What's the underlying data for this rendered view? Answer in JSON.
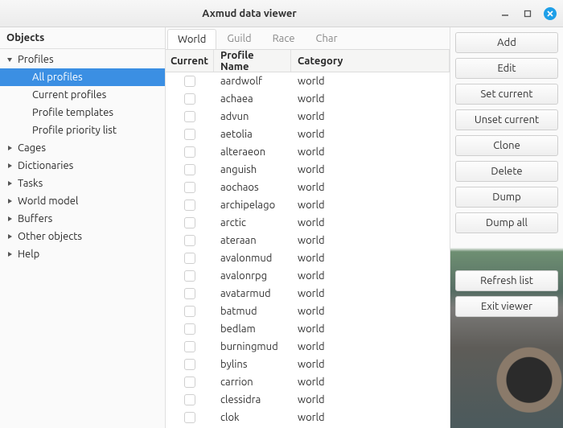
{
  "window": {
    "title": "Axmud data viewer"
  },
  "sidebar": {
    "header": "Objects",
    "items": [
      {
        "label": "Profiles",
        "expanded": true,
        "children": [
          {
            "label": "All profiles",
            "selected": true
          },
          {
            "label": "Current profiles"
          },
          {
            "label": "Profile templates"
          },
          {
            "label": "Profile priority list"
          }
        ]
      },
      {
        "label": "Cages"
      },
      {
        "label": "Dictionaries"
      },
      {
        "label": "Tasks"
      },
      {
        "label": "World model"
      },
      {
        "label": "Buffers"
      },
      {
        "label": "Other objects"
      },
      {
        "label": "Help"
      }
    ]
  },
  "tabs": [
    {
      "label": "World",
      "active": true
    },
    {
      "label": "Guild"
    },
    {
      "label": "Race"
    },
    {
      "label": "Char"
    }
  ],
  "columns": {
    "current": "Current",
    "name": "Profile Name",
    "category": "Category"
  },
  "rows": [
    {
      "name": "aardwolf",
      "category": "world"
    },
    {
      "name": "achaea",
      "category": "world"
    },
    {
      "name": "advun",
      "category": "world"
    },
    {
      "name": "aetolia",
      "category": "world"
    },
    {
      "name": "alteraeon",
      "category": "world"
    },
    {
      "name": "anguish",
      "category": "world"
    },
    {
      "name": "aochaos",
      "category": "world"
    },
    {
      "name": "archipelago",
      "category": "world"
    },
    {
      "name": "arctic",
      "category": "world"
    },
    {
      "name": "ateraan",
      "category": "world"
    },
    {
      "name": "avalonmud",
      "category": "world"
    },
    {
      "name": "avalonrpg",
      "category": "world"
    },
    {
      "name": "avatarmud",
      "category": "world"
    },
    {
      "name": "batmud",
      "category": "world"
    },
    {
      "name": "bedlam",
      "category": "world"
    },
    {
      "name": "burningmud",
      "category": "world"
    },
    {
      "name": "bylins",
      "category": "world"
    },
    {
      "name": "carrion",
      "category": "world"
    },
    {
      "name": "clessidra",
      "category": "world"
    },
    {
      "name": "clok",
      "category": "world"
    }
  ],
  "actions": {
    "group1": [
      "Add",
      "Edit",
      "Set current",
      "Unset current",
      "Clone",
      "Delete",
      "Dump",
      "Dump all"
    ],
    "group2": [
      "Refresh list",
      "Exit viewer"
    ]
  }
}
